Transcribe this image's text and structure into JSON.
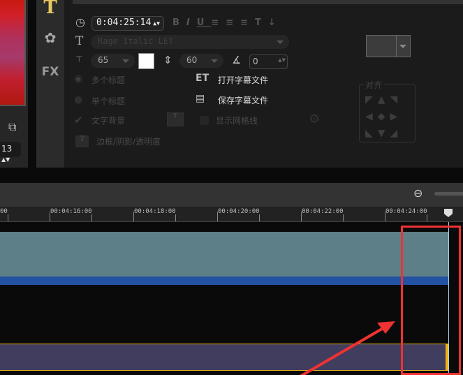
{
  "preview": {
    "spinner_value": "13"
  },
  "tabs": [
    {
      "label": "T",
      "name": "title"
    },
    {
      "label": "✿",
      "name": "effects"
    },
    {
      "label": "FX",
      "name": "fx"
    }
  ],
  "options": {
    "duration": "0:04:25:14",
    "format_buttons": [
      "B",
      "I",
      "U",
      "≡",
      "≡",
      "≡",
      "T↓"
    ],
    "font": "Rage Italic LET",
    "font_size": "65",
    "color": "#ffffff",
    "line_spacing": "60",
    "angle": "0",
    "multi_title": "多个标题",
    "single_title": "单个标题",
    "open_subtitle": "打开字幕文件",
    "save_subtitle": "保存字幕文件",
    "text_background": "文字背景",
    "show_grid": "显示网格线",
    "border_shadow": "边框/阴影/透明度",
    "align_label": "对齐"
  },
  "ruler": {
    "labels": [
      "00",
      "00:04:16:00",
      "00:04:18:00",
      "00:04:20:00",
      "00:04:22:00",
      "00:04:24:00"
    ]
  },
  "colors": {
    "annotation": "#f03232",
    "video_track": "#5d7f88",
    "title_track": "#413d5e"
  }
}
